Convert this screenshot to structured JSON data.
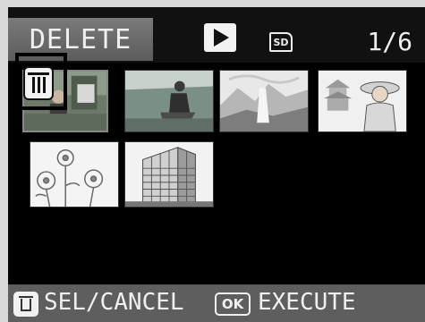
{
  "header": {
    "mode_tab": "DELETE",
    "playback_icon": "play-icon",
    "card_label": "SD",
    "counter": "1/6"
  },
  "thumbnails": [
    {
      "name": "portrait-trees",
      "selected": true,
      "marked_for_delete": true
    },
    {
      "name": "person-sitting-lake"
    },
    {
      "name": "landscape-waterfall"
    },
    {
      "name": "woman-in-hat-pagoda"
    },
    {
      "name": "flowers"
    },
    {
      "name": "tall-building"
    }
  ],
  "footer": {
    "sel_key_icon": "trash-icon",
    "sel_label": "SEL/CANCEL",
    "ok_key": "OK",
    "execute_label": "EXECUTE"
  },
  "colors": {
    "lcd_background": "#000000",
    "tab_background": "#6b6b6b",
    "footer_background": "#5e5e5e",
    "text": "#f0f0f0"
  }
}
